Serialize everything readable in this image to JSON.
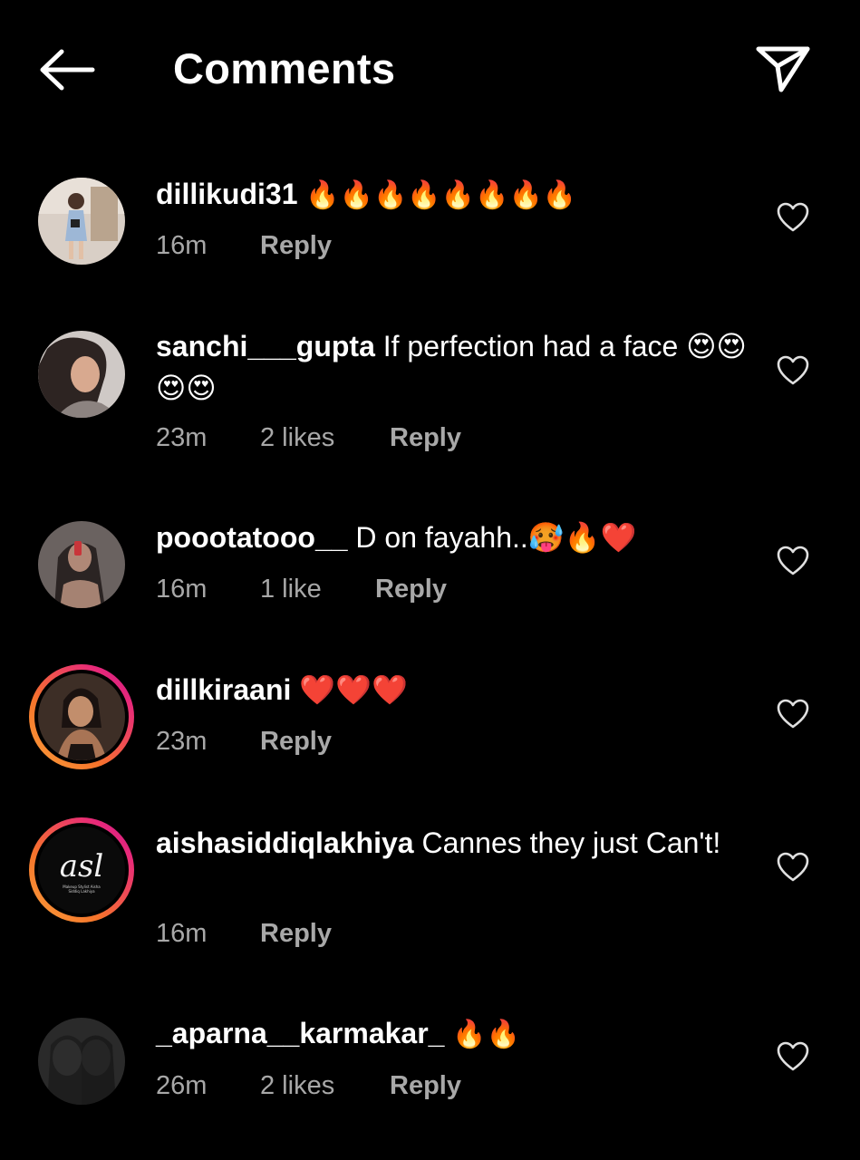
{
  "header": {
    "title": "Comments",
    "back_icon": "arrow-left-icon",
    "share_icon": "paper-plane-icon"
  },
  "colors": {
    "background": "#000000",
    "text": "#ffffff",
    "secondary_text": "#a8a8a8",
    "story_ring_start": "#f9a13b",
    "story_ring_end": "#c1168c"
  },
  "comments": [
    {
      "username": "dillikudi31",
      "text": "🔥🔥🔥🔥🔥🔥🔥🔥",
      "time": "16m",
      "likes": "",
      "reply": "Reply"
    },
    {
      "username": "sanchi___gupta",
      "text": "If perfection had a face 😍😍😍😍",
      "time": "23m",
      "likes": "2 likes",
      "reply": "Reply"
    },
    {
      "username": "poootatooo__",
      "text": "D on fayahh..🥵🔥❤️",
      "time": "16m",
      "likes": "1 like",
      "reply": "Reply"
    },
    {
      "username": "dillkiraani",
      "text": "❤️❤️❤️",
      "time": "23m",
      "likes": "",
      "reply": "Reply"
    },
    {
      "username": "aishasiddiqlakhiya",
      "text": "Cannes they just Can't!",
      "time": "16m",
      "likes": "",
      "reply": "Reply",
      "avatar_logo": "asl",
      "avatar_logo_sub": "Makeup Stylist Aisha Siddiq Lakhiya"
    },
    {
      "username": "_aparna__karmakar_",
      "text": "🔥🔥",
      "time": "26m",
      "likes": "2 likes",
      "reply": "Reply"
    }
  ]
}
